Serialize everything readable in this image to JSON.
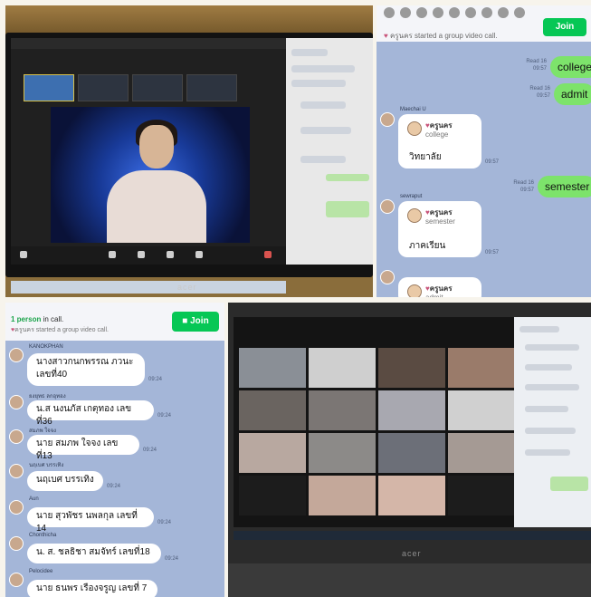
{
  "panel_top_right": {
    "header_line1": "",
    "header_line2": "started a group video call.",
    "caller": "ครูนคร",
    "join_label": "Join",
    "messages": [
      {
        "type": "sent",
        "text": "college",
        "meta": "Read 16\n09:57"
      },
      {
        "type": "sent",
        "text": "admit",
        "meta": "Read 16\n09:57"
      },
      {
        "type": "recv",
        "sender": "Maechai U",
        "sticker_name": "ครูนคร",
        "sticker_word": "college",
        "text": "วิทยาลัย",
        "time": "09:57"
      },
      {
        "type": "sent",
        "text": "semester",
        "meta": "Read 16\n09:57"
      },
      {
        "type": "recv",
        "sender": "sewraput",
        "sticker_name": "ครูนคร",
        "sticker_word": "semester",
        "text": "ภาคเรียน",
        "time": "09:57"
      },
      {
        "type": "recv_partial",
        "sender": "",
        "sticker_name": "ครูนคร",
        "sticker_word": "admit"
      }
    ]
  },
  "panel_bottom_left": {
    "in_call_count": "1 person",
    "in_call_suffix": " in call.",
    "started": "started a group video call.",
    "caller": "ครูนคร",
    "join_label": "Join",
    "roster": [
      {
        "sender": "KANOKPHAN",
        "text": "นางสาวกนกพรรณ ภวนะ\nเลขที่40",
        "time": "09:24"
      },
      {
        "sender": "ยงยุทธ ลกอุทอง",
        "text": "น.ส นงนภัส เกตุทอง เลขที่36",
        "time": "09:24"
      },
      {
        "sender": "สมภพ ใจจง",
        "text": "นาย สมภพ ใจจง เลขที่13",
        "time": "09:24"
      },
      {
        "sender": "นฤเบศ บรรเทิง",
        "text": "นฤเบศ บรรเทิง",
        "time": "09:24"
      },
      {
        "sender": "Aun",
        "text": "นาย สุวพัชร นพลกุล เลขที่ 14",
        "time": "09:24"
      },
      {
        "sender": "Chonthicha",
        "text": "น. ส. ชลธิชา สมจัทร์ เลขที่18",
        "time": "09:24"
      },
      {
        "sender": "Pelocidee",
        "text": "นาย ธนพร เรืองจรูญ เลขที่ 7",
        "time": ""
      }
    ]
  },
  "laptop_brand": "acer"
}
